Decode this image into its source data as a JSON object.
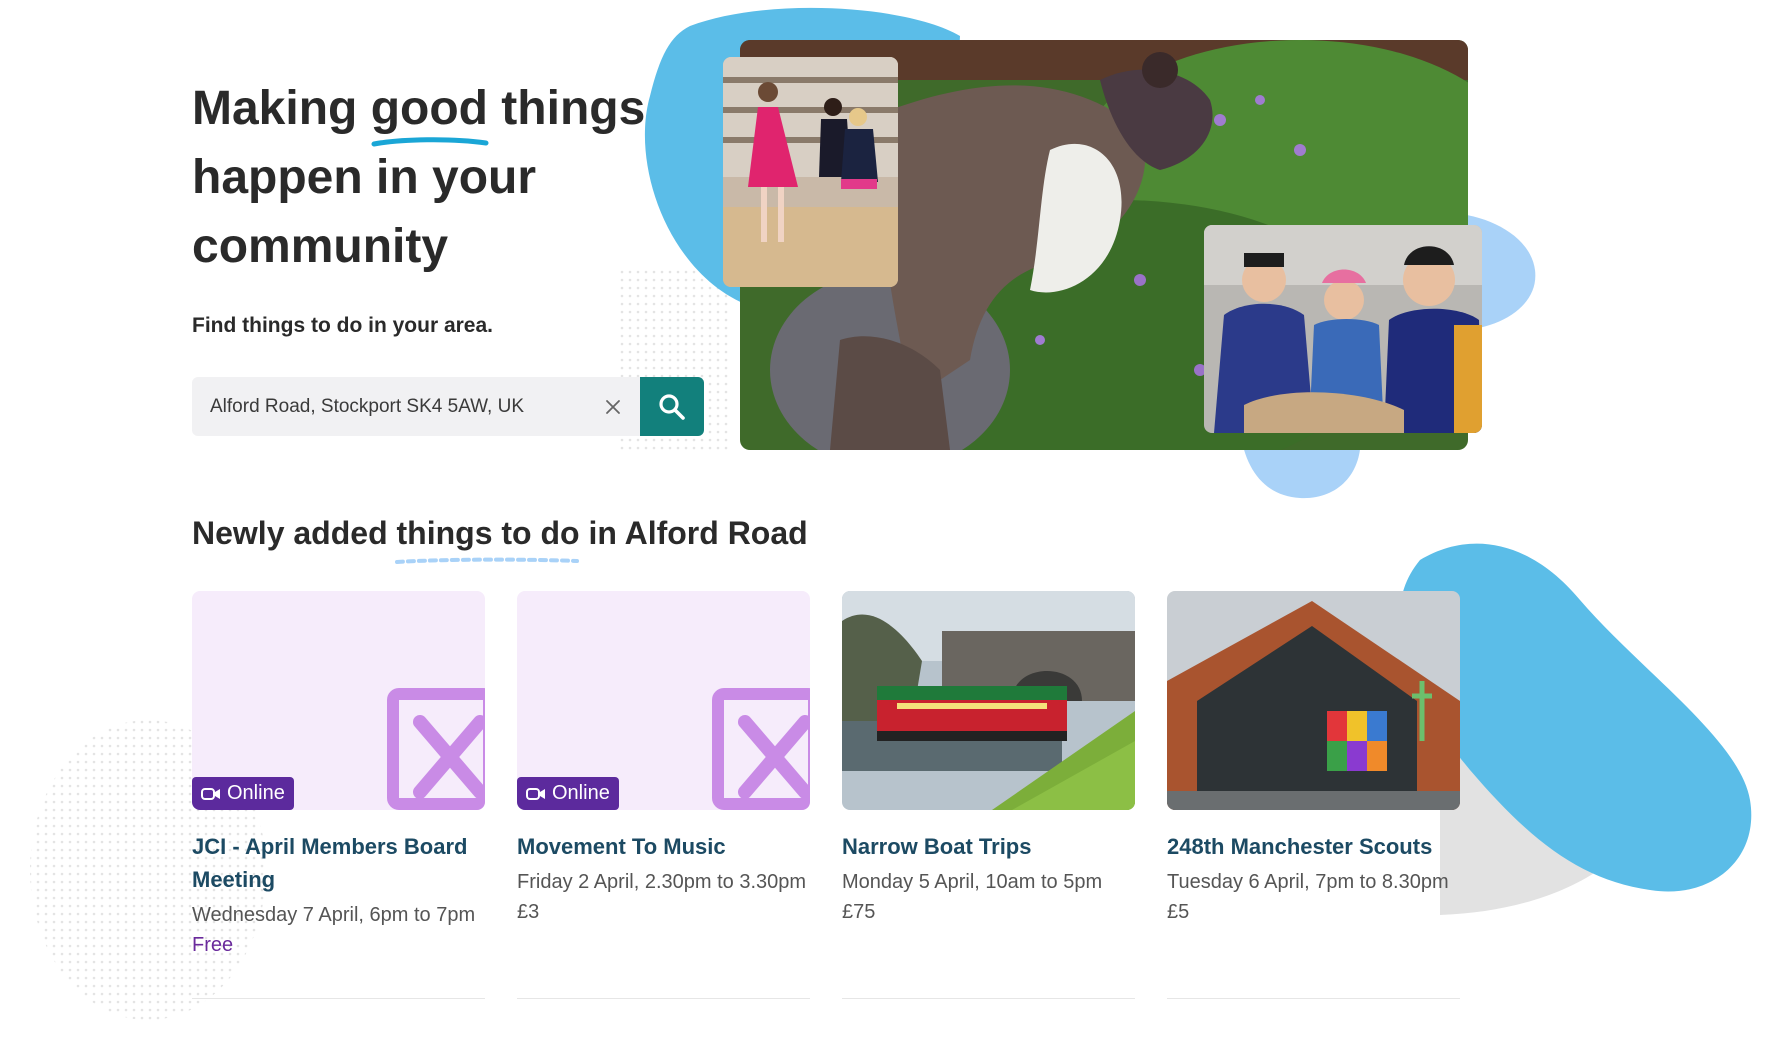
{
  "hero": {
    "title_before": "Making ",
    "title_highlight": "good",
    "title_after": " things happen in your community",
    "subtitle": "Find things to do in your area."
  },
  "search": {
    "value": "Alford Road, Stockport SK4 5AW, UK",
    "placeholder": "Enter a location"
  },
  "section": {
    "title_before": "Newly added ",
    "title_highlight": "things to do",
    "title_after": " in Alford Road"
  },
  "cards": [
    {
      "badge": "Online",
      "title": "JCI - April Members Board Meeting",
      "date": "Wednesday 7 April, 6pm to 7pm",
      "price": "Free"
    },
    {
      "badge": "Online",
      "title": "Movement To Music",
      "date": "Friday 2 April, 2.30pm to 3.30pm",
      "price": "£3"
    },
    {
      "title": "Narrow Boat Trips",
      "date": "Monday 5 April, 10am to 5pm",
      "price": "£75"
    },
    {
      "title": "248th Manchester Scouts",
      "date": "Tuesday 6 April, 7pm to 8.30pm",
      "price": "£5"
    }
  ],
  "colors": {
    "accent_teal": "#12807c",
    "title_blue": "#1c4a63",
    "online_purple": "#5c2a9d",
    "free_purple": "#6a2a9c",
    "blob_blue": "#5bbde8",
    "placeholder_lilac": "#f6ecfb"
  }
}
